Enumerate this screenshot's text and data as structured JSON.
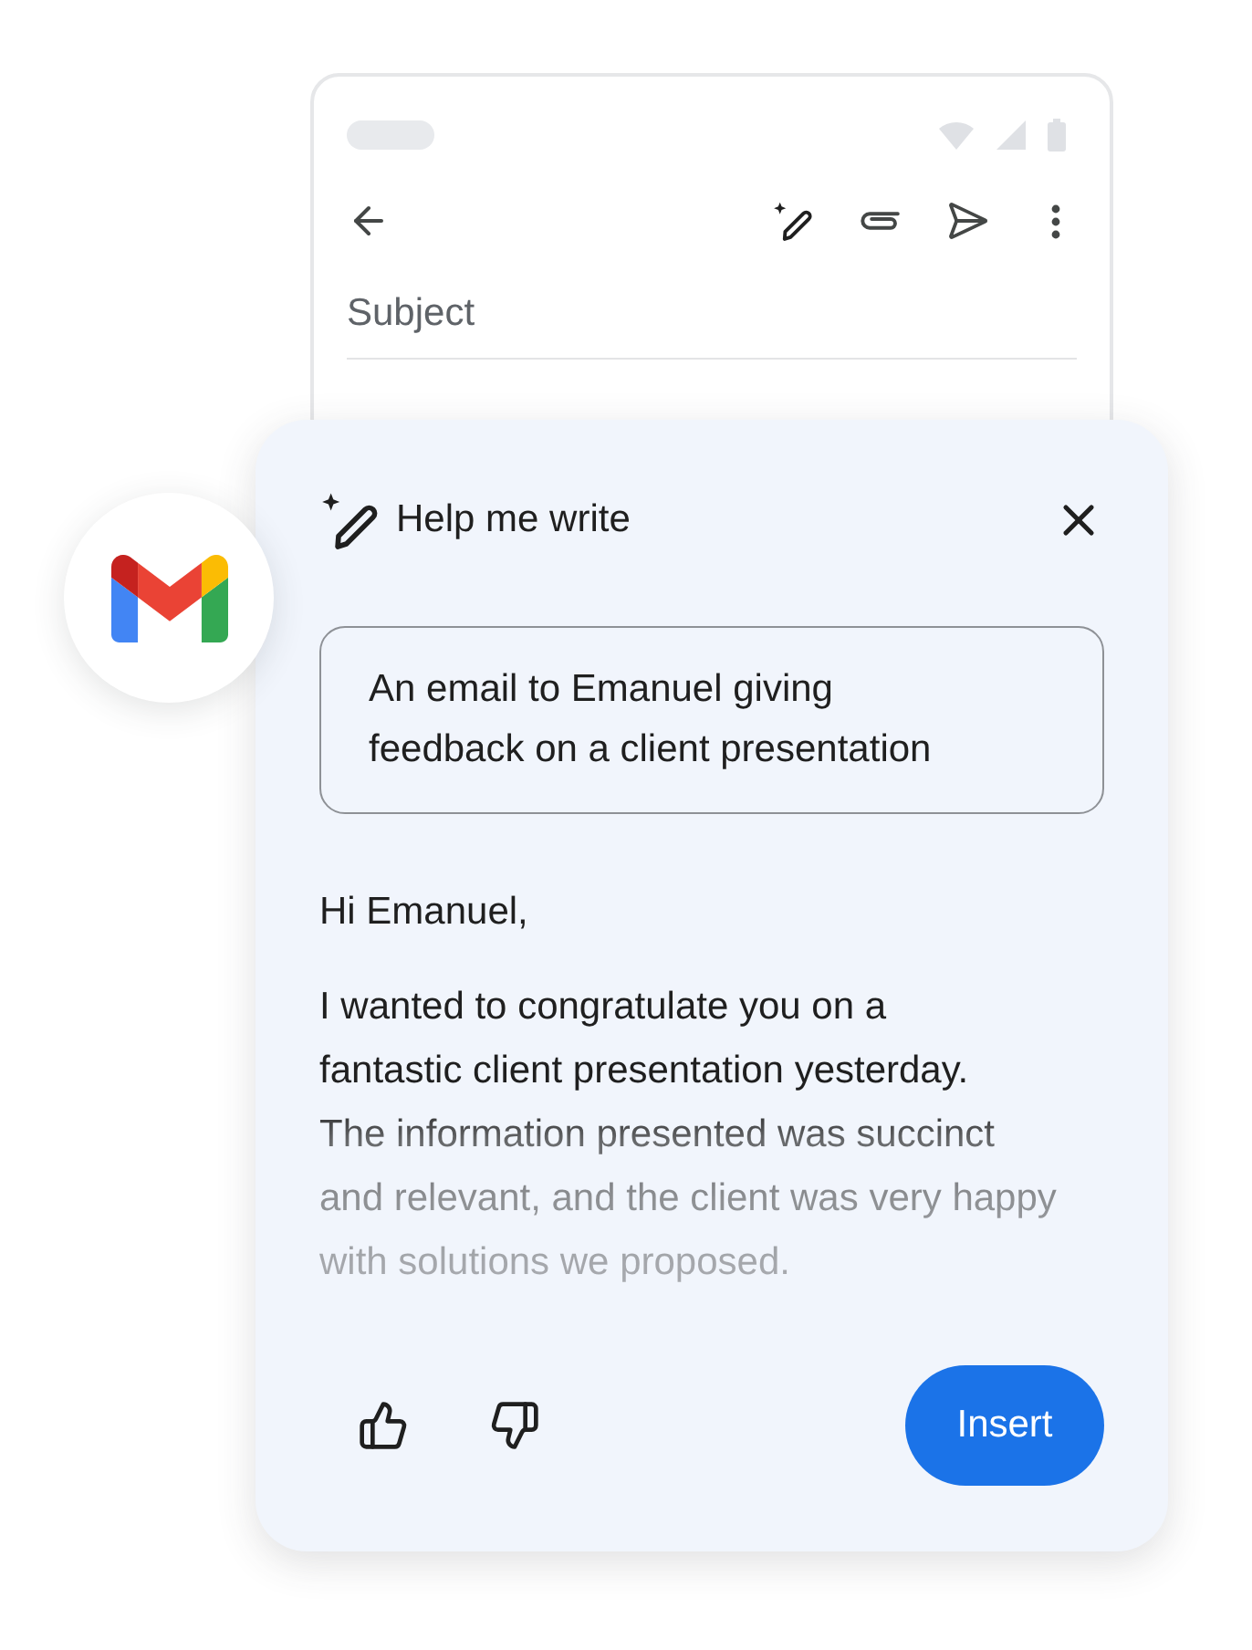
{
  "compose": {
    "subject": {
      "placeholder": "Subject"
    }
  },
  "help_me_write": {
    "title": "Help me write",
    "prompt": {
      "value": "An email to Emanuel giving feedback on a client presentation"
    },
    "draft": {
      "greeting": "Hi Emanuel,",
      "body": "I wanted to congratulate you on a\nfantastic client presentation yesterday.\nThe information presented was succinct\nand relevant, and the client was very happy\nwith solutions we proposed."
    },
    "insert_button": "Insert"
  }
}
